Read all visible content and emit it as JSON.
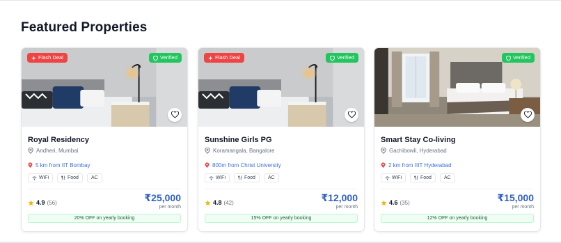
{
  "section_title": "Featured Properties",
  "badges": {
    "flash": "Flash Deal",
    "verified": "Verified"
  },
  "per_month_label": "per month",
  "amenity_icons": {
    "WiFi": "wifi-icon",
    "Food": "utensils-icon",
    "AC": ""
  },
  "colors": {
    "flash": "#ef4444",
    "verified": "#22c55e",
    "price": "#2f5fc4",
    "distance": "#3b6fd8",
    "star": "#f5b301"
  },
  "properties": [
    {
      "name": "Royal Residency",
      "location": "Andheri, Mumbai",
      "distance": "5 km from IIT Bombay",
      "amenities": [
        "WiFi",
        "Food",
        "AC"
      ],
      "rating": "4.9",
      "reviews": "(56)",
      "price": "₹25,000",
      "offer": "20% OFF on yearly booking",
      "flash_deal": true,
      "image": "bedroom-dark-pillows"
    },
    {
      "name": "Sunshine Girls PG",
      "location": "Koramangala, Bangalore",
      "distance": "800m from Christ University",
      "amenities": [
        "WiFi",
        "Food",
        "AC"
      ],
      "rating": "4.8",
      "reviews": "(42)",
      "price": "₹12,000",
      "offer": "15% OFF on yearly booking",
      "flash_deal": true,
      "image": "bedroom-dark-pillows"
    },
    {
      "name": "Smart Stay Co-living",
      "location": "Gachibowli, Hyderabad",
      "distance": "2 km from IIIT Hyderabad",
      "amenities": [
        "WiFi",
        "Food",
        "AC"
      ],
      "rating": "4.6",
      "reviews": "(35)",
      "price": "₹15,000",
      "offer": "12% OFF on yearly booking",
      "flash_deal": false,
      "image": "hotel-room-window"
    }
  ]
}
